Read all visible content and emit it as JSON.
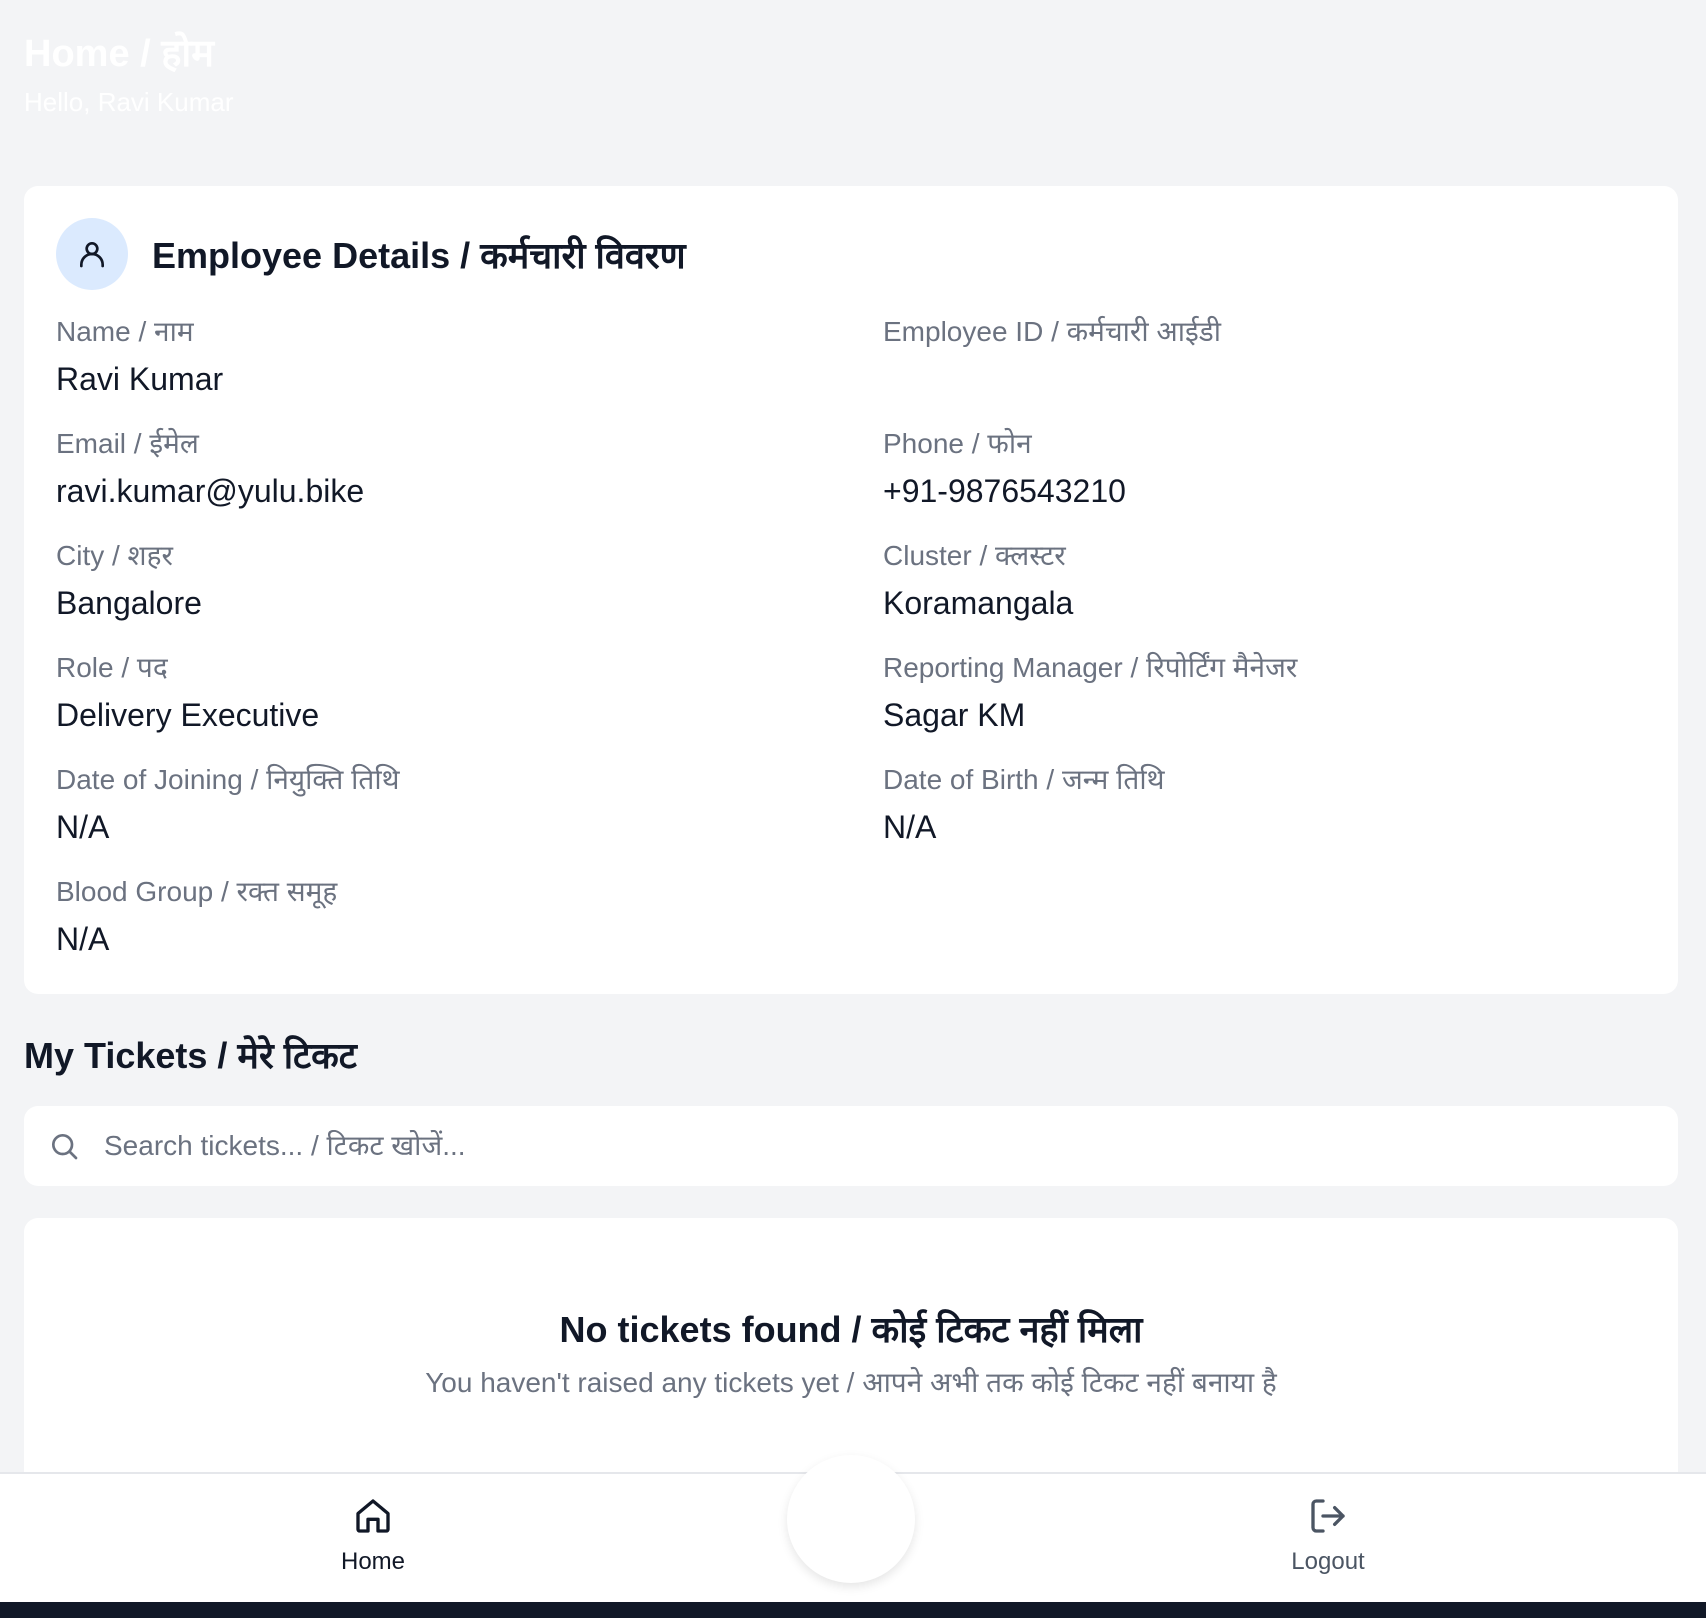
{
  "header": {
    "title": "Home / होम",
    "greeting": "Hello, Ravi Kumar"
  },
  "employee_card": {
    "title": "Employee Details / कर्मचारी विवरण",
    "icon": "user-icon",
    "fields": {
      "name": {
        "label": "Name / नाम",
        "value": "Ravi Kumar"
      },
      "employee_id": {
        "label": "Employee ID / कर्मचारी आईडी",
        "value": ""
      },
      "email": {
        "label": "Email / ईमेल",
        "value": "ravi.kumar@yulu.bike"
      },
      "phone": {
        "label": "Phone / फोन",
        "value": "+91-9876543210"
      },
      "city": {
        "label": "City / शहर",
        "value": "Bangalore"
      },
      "cluster": {
        "label": "Cluster / क्लस्टर",
        "value": "Koramangala"
      },
      "role": {
        "label": "Role / पद",
        "value": "Delivery Executive"
      },
      "reporting_manager": {
        "label": "Reporting Manager / रिपोर्टिंग मैनेजर",
        "value": "Sagar KM"
      },
      "date_of_joining": {
        "label": "Date of Joining / नियुक्ति तिथि",
        "value": "N/A"
      },
      "date_of_birth": {
        "label": "Date of Birth / जन्म तिथि",
        "value": "N/A"
      },
      "blood_group": {
        "label": "Blood Group / रक्त समूह",
        "value": "N/A"
      }
    }
  },
  "tickets": {
    "title": "My Tickets / मेरे टिकट",
    "search_placeholder": "Search tickets... / टिकट खोजें...",
    "empty_title": "No tickets found / कोई टिकट नहीं मिला",
    "empty_subtitle": "You haven't raised any tickets yet / आपने अभी तक कोई टिकट नहीं बनाया है"
  },
  "bottom_nav": {
    "home_label": "Home",
    "logout_label": "Logout"
  },
  "colors": {
    "background": "#f3f4f6",
    "card": "#ffffff",
    "avatar_bg": "#dbeafe",
    "label_text": "#6b7280",
    "value_text": "#111827"
  }
}
